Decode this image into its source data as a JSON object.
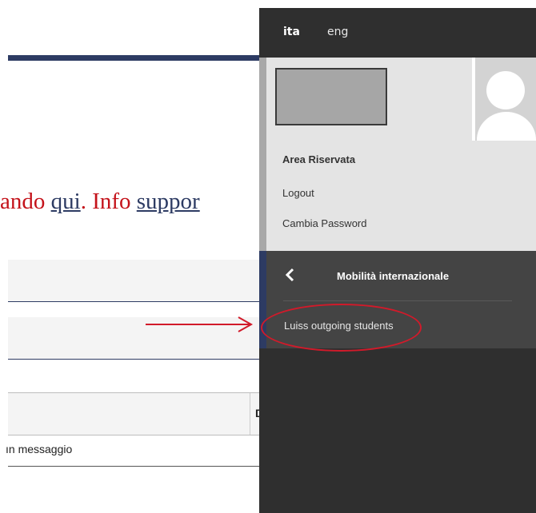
{
  "page": {
    "notice": {
      "text_prefix": "ando ",
      "link_qui": "qui",
      "text_mid": ". Info ",
      "link_support": "suppor"
    },
    "table": {
      "col_header_fragment": "D"
    },
    "message_row": "ın messaggio"
  },
  "panel": {
    "languages": [
      {
        "label": "ita",
        "active": true
      },
      {
        "label": "eng",
        "active": false
      }
    ],
    "area_riservata": "Area Riservata",
    "logout": "Logout",
    "cambia_password": "Cambia Password",
    "submenu": {
      "title": "Mobilità internazionale",
      "items": [
        {
          "label": "Luiss outgoing students"
        }
      ]
    }
  },
  "colors": {
    "notice_red": "#c4121a",
    "navy": "#2d3b63",
    "panel_dark": "#2f2f2f",
    "annotation_red": "#d11a2a"
  },
  "icons": [
    "chevron-left-icon",
    "user-avatar-icon",
    "arrow-right-annotation"
  ]
}
